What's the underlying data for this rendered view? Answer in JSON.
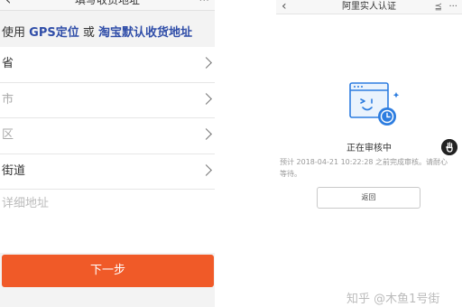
{
  "left_screen": {
    "nav": {
      "back_icon": "chevron-left-icon",
      "title": "填写收货地址",
      "more": "···"
    },
    "banner": {
      "prefix": "使用",
      "gps_link": "GPS定位",
      "or_text": "或",
      "taobao_link": "淘宝默认收货地址"
    },
    "fields": [
      {
        "label": "省",
        "has_chevron": true
      },
      {
        "label": "市",
        "has_chevron": true
      },
      {
        "label": "区",
        "has_chevron": true
      },
      {
        "label": "街道",
        "has_chevron": true
      }
    ],
    "detail_address_placeholder": "详细地址",
    "next_button": "下一步",
    "next_button_color": "#f05a28",
    "link_color": "#2f4da8"
  },
  "right_screen": {
    "nav": {
      "back_icon": "chevron-left-icon",
      "title": "阿里实人认证",
      "share_icon": "share-icon",
      "more": "···"
    },
    "illustration_icon": "review-window-clock-icon",
    "status_text": "正在审核中",
    "description": "预计 2018-04-21 10:22:28 之前完成审核。请耐心等待。",
    "return_button": "返回",
    "accent_color": "#2d7de0",
    "floating_icon": "hand-pointer-icon"
  },
  "watermark": "知乎 @木鱼1号街"
}
